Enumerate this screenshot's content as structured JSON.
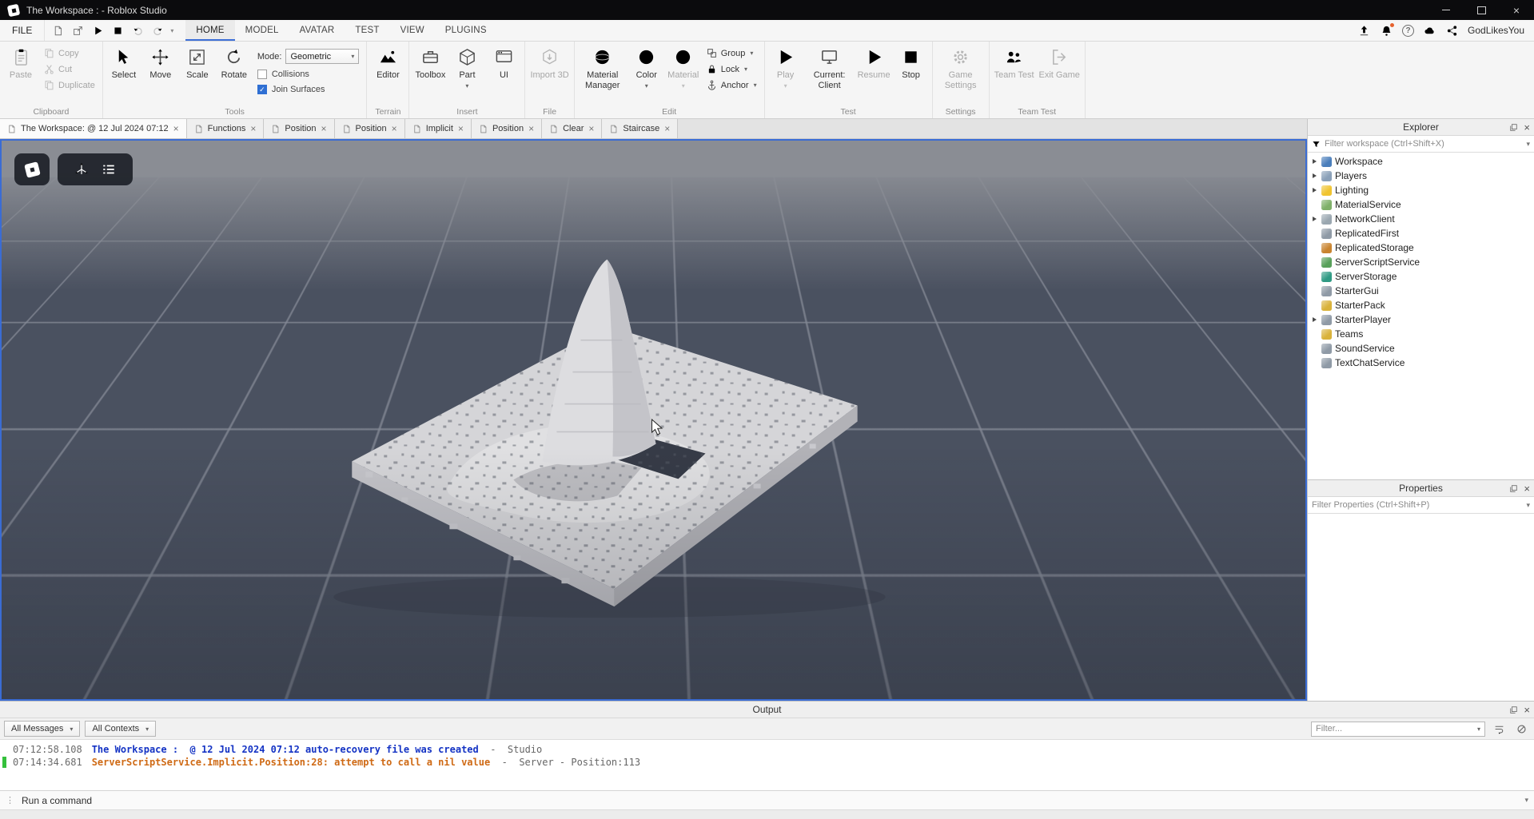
{
  "icons": {
    "close": "×",
    "chevron_down": "▾",
    "check": "✓",
    "grip": "⋮",
    "help": "?"
  },
  "colors": {
    "accent_blue": "#3d6fd7",
    "stop_red": "#c93a2b",
    "viewport_sky": "#8a8d94",
    "grid_tile": "#4a5160",
    "terrain_light": "#d5d5d8",
    "log_info_blue": "#1433c4",
    "log_error_orange": "#cf6a15",
    "server_marker_green": "#35c03c"
  },
  "titlebar": {
    "title": "The Workspace :  - Roblox Studio"
  },
  "menubar": {
    "file": "FILE",
    "tabs": [
      {
        "label": "HOME",
        "active": true
      },
      {
        "label": "MODEL",
        "active": false
      },
      {
        "label": "AVATAR",
        "active": false
      },
      {
        "label": "TEST",
        "active": false
      },
      {
        "label": "VIEW",
        "active": false
      },
      {
        "label": "PLUGINS",
        "active": false
      }
    ],
    "username": "GodLikesYou"
  },
  "ribbon": {
    "clipboard": {
      "label": "Clipboard",
      "paste": "Paste",
      "copy": "Copy",
      "cut": "Cut",
      "duplicate": "Duplicate"
    },
    "tools": {
      "label": "Tools",
      "select": "Select",
      "move": "Move",
      "scale": "Scale",
      "rotate": "Rotate",
      "mode_label": "Mode:",
      "mode_value": "Geometric",
      "collisions": "Collisions",
      "join_surfaces": "Join Surfaces"
    },
    "terrain": {
      "label": "Terrain",
      "editor": "Editor"
    },
    "insert": {
      "label": "Insert",
      "toolbox": "Toolbox",
      "part": "Part",
      "ui": "UI"
    },
    "file": {
      "label": "File",
      "import3d": "Import 3D"
    },
    "edit": {
      "label": "Edit",
      "material_manager": "Material Manager",
      "color": "Color",
      "material": "Material",
      "group": "Group",
      "lock": "Lock",
      "anchor": "Anchor"
    },
    "test": {
      "label": "Test",
      "play": "Play",
      "current_client": "Current: Client",
      "resume": "Resume",
      "stop": "Stop"
    },
    "settings": {
      "label": "Settings",
      "game_settings": "Game Settings"
    },
    "team_test": {
      "label": "Team Test",
      "team_test": "Team Test",
      "exit_game": "Exit Game"
    }
  },
  "doc_tabs": [
    {
      "label": "The Workspace: @ 12 Jul 2024 07:12",
      "active": true
    },
    {
      "label": "Functions",
      "active": false
    },
    {
      "label": "Position",
      "active": false
    },
    {
      "label": "Position",
      "active": false
    },
    {
      "label": "Implicit",
      "active": false
    },
    {
      "label": "Position",
      "active": false
    },
    {
      "label": "Clear",
      "active": false
    },
    {
      "label": "Staircase",
      "active": false
    }
  ],
  "explorer": {
    "title": "Explorer",
    "filter_placeholder": "Filter workspace (Ctrl+Shift+X)",
    "items": [
      {
        "label": "Workspace",
        "expandable": true,
        "color": "#4a7ebb"
      },
      {
        "label": "Players",
        "expandable": true,
        "color": "#8aa0b8"
      },
      {
        "label": "Lighting",
        "expandable": true,
        "color": "#f0c430"
      },
      {
        "label": "MaterialService",
        "expandable": false,
        "color": "#7fb069"
      },
      {
        "label": "NetworkClient",
        "expandable": true,
        "color": "#9aa7b0"
      },
      {
        "label": "ReplicatedFirst",
        "expandable": false,
        "color": "#8f9aa6"
      },
      {
        "label": "ReplicatedStorage",
        "expandable": false,
        "color": "#c9842f"
      },
      {
        "label": "ServerScriptService",
        "expandable": false,
        "color": "#58a05a"
      },
      {
        "label": "ServerStorage",
        "expandable": false,
        "color": "#2f9a84"
      },
      {
        "label": "StarterGui",
        "expandable": false,
        "color": "#8f9aa6"
      },
      {
        "label": "StarterPack",
        "expandable": false,
        "color": "#d9b23a"
      },
      {
        "label": "StarterPlayer",
        "expandable": true,
        "color": "#8f9aa6"
      },
      {
        "label": "Teams",
        "expandable": false,
        "color": "#d9b23a"
      },
      {
        "label": "SoundService",
        "expandable": false,
        "color": "#8f9aa6"
      },
      {
        "label": "TextChatService",
        "expandable": false,
        "color": "#8f9aa6"
      }
    ]
  },
  "properties": {
    "title": "Properties",
    "filter_placeholder": "Filter Properties (Ctrl+Shift+P)"
  },
  "output": {
    "title": "Output",
    "all_messages": "All Messages",
    "all_contexts": "All Contexts",
    "filter_placeholder": "Filter...",
    "logs": [
      {
        "time": "07:12:58.108",
        "message": "The Workspace :  @ 12 Jul 2024 07:12 auto-recovery file was created",
        "suffix": "  -  Studio",
        "color": "#1433c4",
        "marker": false
      },
      {
        "time": "07:14:34.681",
        "message": "ServerScriptService.Implicit.Position:28: attempt to call a nil value",
        "suffix": "  -  Server - Position:113",
        "color": "#cf6a15",
        "marker": true
      }
    ]
  },
  "command_bar": {
    "placeholder": "Run a command"
  }
}
